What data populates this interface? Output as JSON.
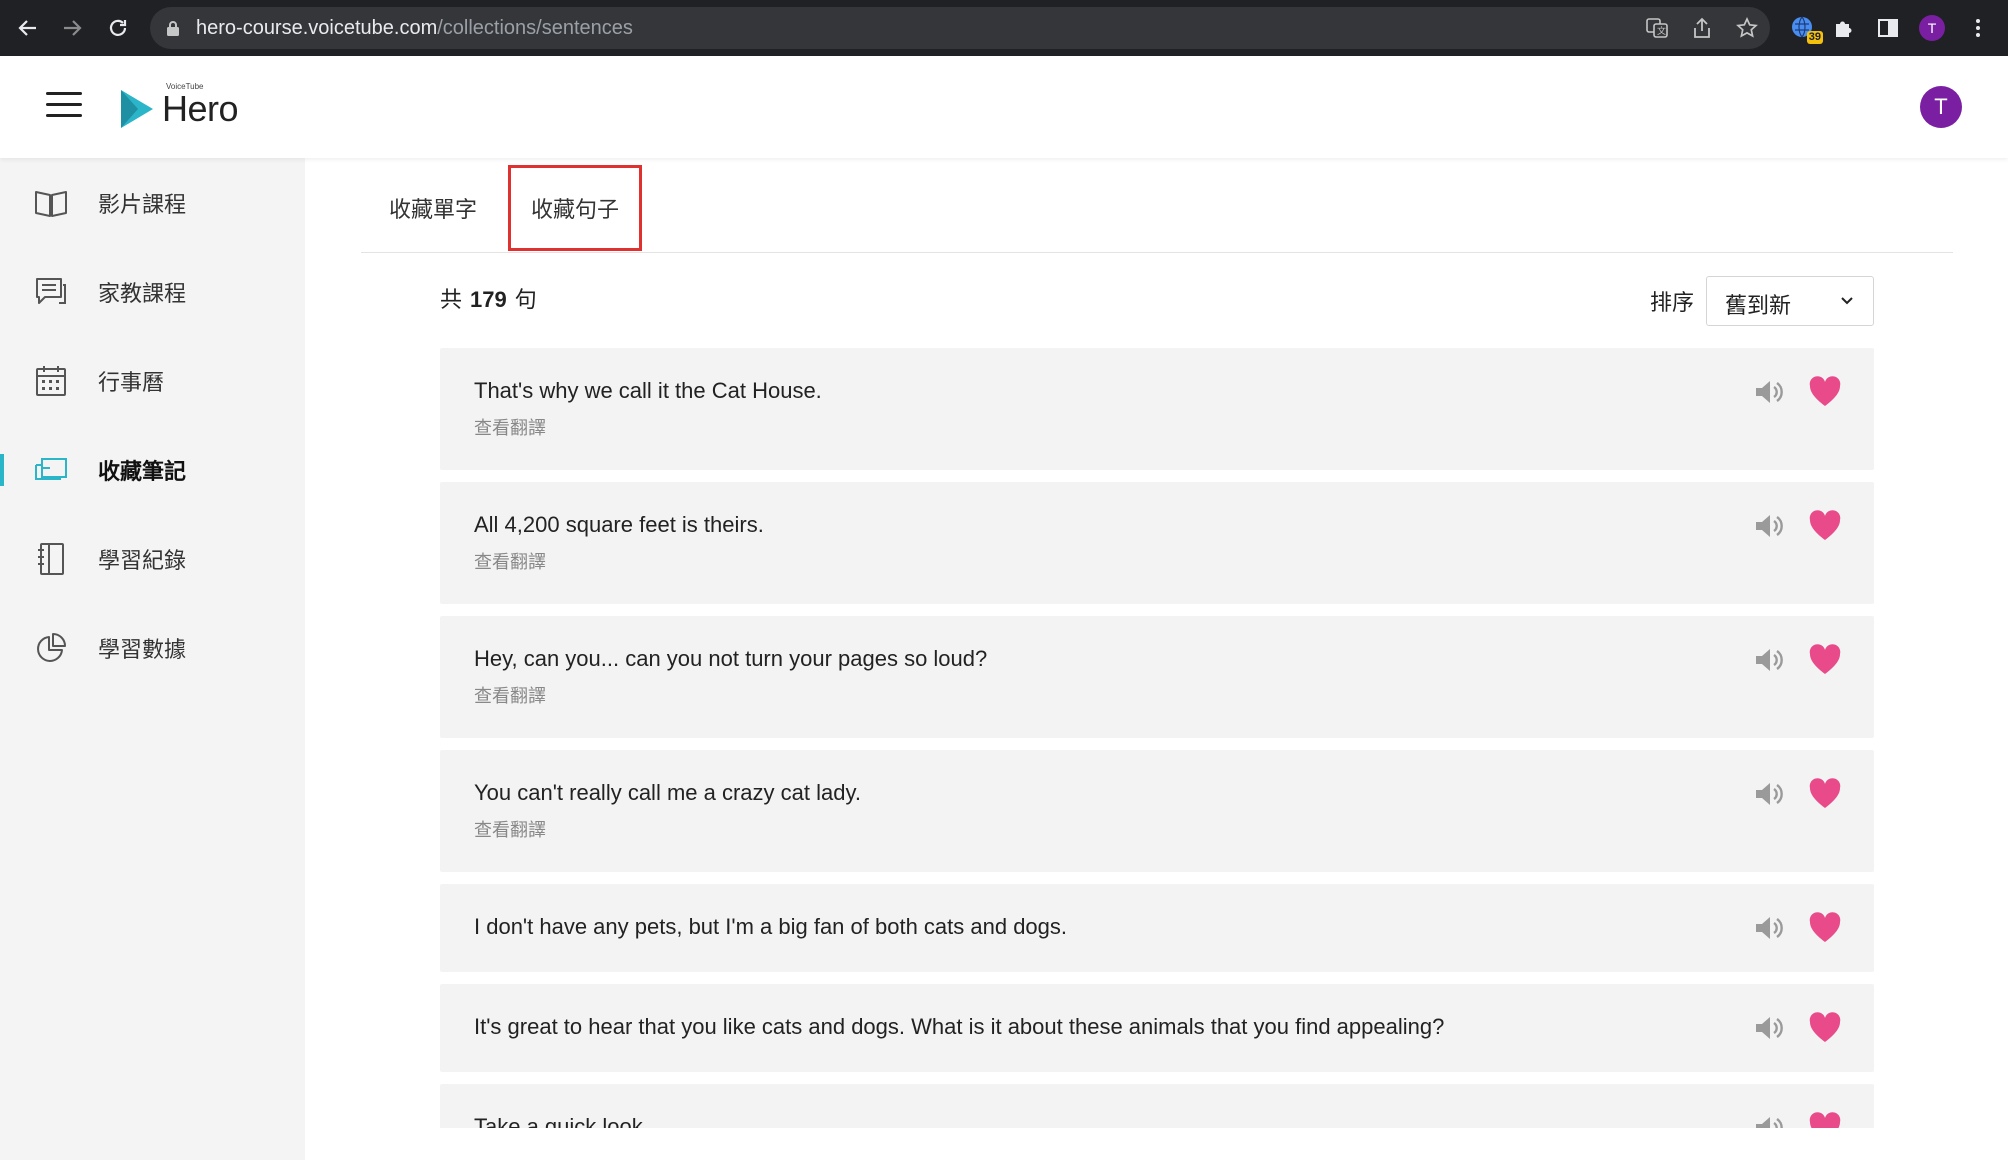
{
  "browser": {
    "url_host": "hero-course.voicetube.com",
    "url_path": "/collections/sentences",
    "extension_badge": "39",
    "profile_initial": "T"
  },
  "header": {
    "logo_small": "VoiceTube",
    "logo_text": "Hero",
    "avatar_initial": "T"
  },
  "sidebar": {
    "items": [
      {
        "label": "影片課程",
        "icon": "book-open-icon"
      },
      {
        "label": "家教課程",
        "icon": "chat-lines-icon"
      },
      {
        "label": "行事曆",
        "icon": "calendar-icon"
      },
      {
        "label": "收藏筆記",
        "icon": "bookmark-cards-icon",
        "active": true
      },
      {
        "label": "學習紀錄",
        "icon": "notebook-icon"
      },
      {
        "label": "學習數據",
        "icon": "pie-chart-icon"
      }
    ]
  },
  "tabs": [
    {
      "label": "收藏單字"
    },
    {
      "label": "收藏句子",
      "active": true
    }
  ],
  "summary": {
    "prefix": "共",
    "count": "179",
    "suffix": "句"
  },
  "sort": {
    "label": "排序",
    "value": "舊到新"
  },
  "sentences": [
    {
      "text": "That's why we call it the Cat House.",
      "translation_link": "查看翻譯"
    },
    {
      "text": "All 4,200 square feet is theirs.",
      "translation_link": "查看翻譯"
    },
    {
      "text": "Hey, can you... can you not turn your pages so loud?",
      "translation_link": "查看翻譯"
    },
    {
      "text": "You can't really call me a crazy cat lady.",
      "translation_link": "查看翻譯"
    },
    {
      "text": "I don't have any pets, but I'm a big fan of both cats and dogs.",
      "translation_link": ""
    },
    {
      "text": "It's great to hear that you like cats and dogs. What is it about these animals that you find appealing?",
      "translation_link": ""
    },
    {
      "text": "Take a quick look",
      "translation_link": ""
    }
  ],
  "colors": {
    "accent": "#2bb5c9",
    "heart": "#e84a8a",
    "highlight_box": "#e03131",
    "avatar": "#7b1fa2"
  }
}
